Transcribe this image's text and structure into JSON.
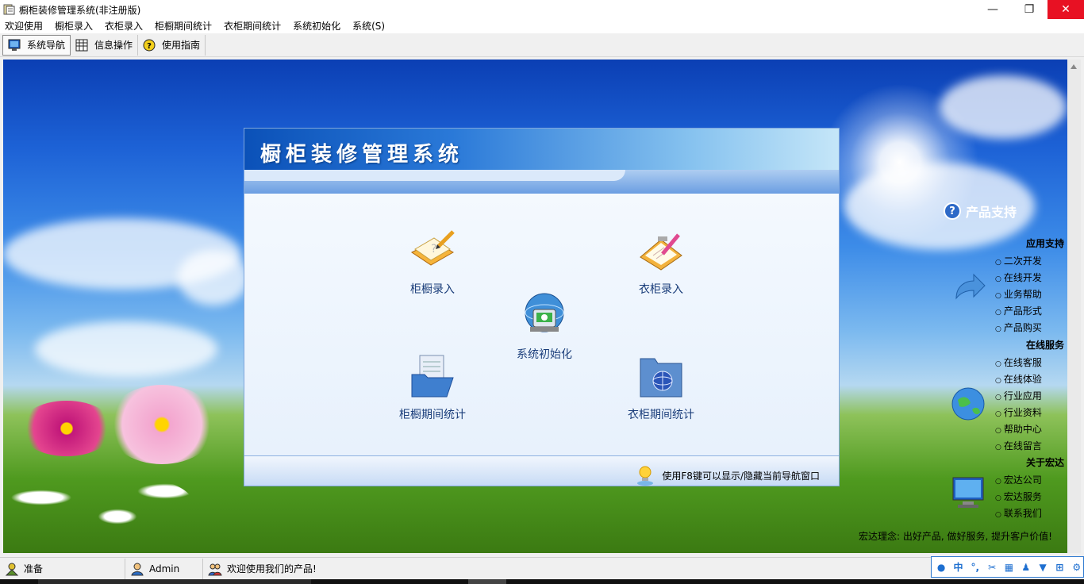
{
  "window": {
    "title": "橱柜装修管理系统(非注册版)",
    "minimize": "—",
    "restore": "❐",
    "close": "✕"
  },
  "menu": [
    "欢迎使用",
    "橱柜录入",
    "衣柜录入",
    "柜橱期间统计",
    "衣柜期间统计",
    "系统初始化",
    "系统(S)"
  ],
  "toolbar": {
    "nav_label": "系统导航",
    "info_label": "信息操作",
    "guide_label": "使用指南"
  },
  "panel": {
    "title": "橱柜装修管理系统",
    "tiles": {
      "cabinet_entry": "柜橱录入",
      "wardrobe_entry": "衣柜录入",
      "system_init": "系统初始化",
      "cabinet_stats": "柜橱期间统计",
      "wardrobe_stats": "衣柜期间统计"
    },
    "tip": "使用F8键可以显示/隐藏当前导航窗口"
  },
  "support": {
    "title": "产品支持",
    "groups": [
      {
        "title": "应用支持",
        "links": [
          "二次开发",
          "在线开发",
          "业务帮助",
          "产品形式",
          "产品购买"
        ]
      },
      {
        "title": "在线服务",
        "links": [
          "在线客服",
          "在线体验",
          "行业应用",
          "行业资料",
          "帮助中心",
          "在线留言"
        ]
      },
      {
        "title": "关于宏达",
        "links": [
          "宏达公司",
          "宏达服务",
          "联系我们"
        ]
      }
    ],
    "slogan": "宏达理念: 出好产品, 做好服务, 提升客户价值!"
  },
  "status": {
    "ready": "准备",
    "user": "Admin",
    "welcome": "欢迎使用我们的产品!"
  },
  "tray": {
    "ime": "中",
    "punct": "°,"
  },
  "colors": {
    "title_close": "#e81123",
    "panel_header": "#0b51b8",
    "tile_label": "#1a3d7a",
    "tray_border": "#2f7ad0"
  }
}
